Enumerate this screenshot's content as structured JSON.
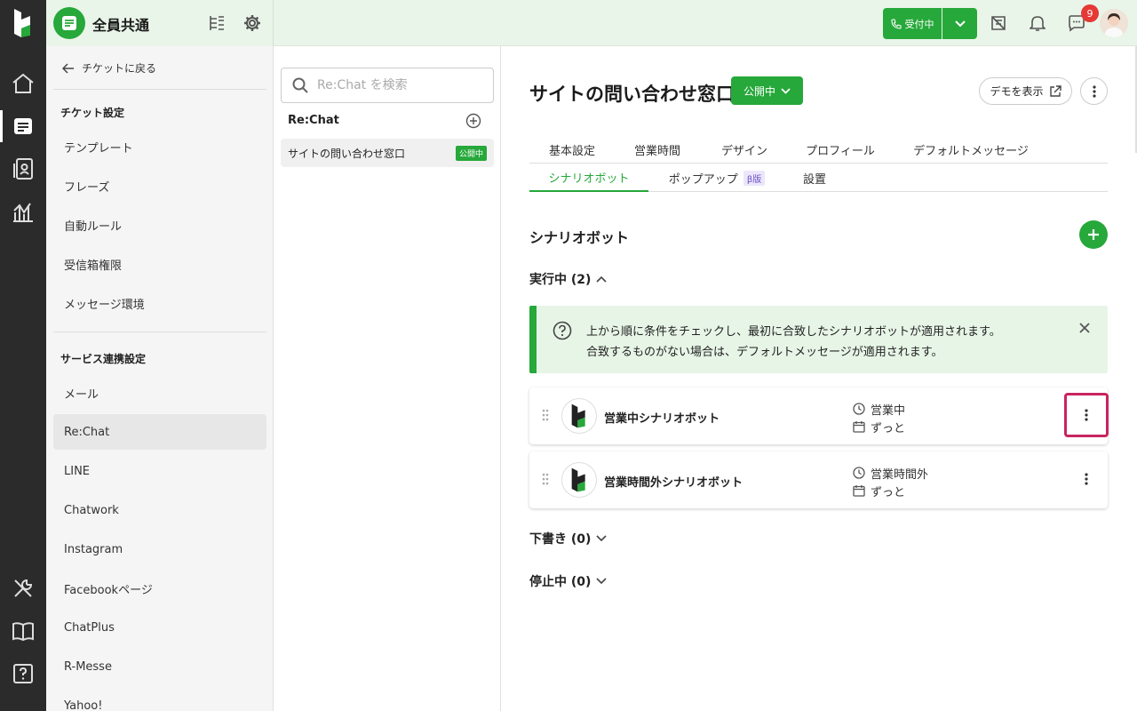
{
  "topbar": {
    "title": "全員共通",
    "status_label": "受付中",
    "notification_count": "9"
  },
  "settings_sidebar": {
    "back_label": "チケットに戻る",
    "ticket_section_title": "チケット設定",
    "ticket_items": [
      "テンプレート",
      "フレーズ",
      "自動ルール",
      "受信箱権限",
      "メッセージ環境"
    ],
    "service_section_title": "サービス連携設定",
    "service_items": [
      "メール",
      "Re:Chat",
      "LINE",
      "Chatwork",
      "Instagram",
      "Facebookページ",
      "ChatPlus",
      "R-Messe",
      "Yahoo!"
    ],
    "active_item": "Re:Chat"
  },
  "list_panel": {
    "search_placeholder": "Re:Chat を検索",
    "header": "Re:Chat",
    "item_label": "サイトの問い合わせ窓口",
    "item_badge": "公開中"
  },
  "main": {
    "title": "サイトの問い合わせ窓口",
    "status_dropdown": "公開中",
    "demo_button": "デモを表示",
    "tabs_row1": [
      "基本設定",
      "営業時間",
      "デザイン",
      "プロフィール",
      "デフォルトメッセージ"
    ],
    "tabs_row2": [
      "シナリオボット",
      "ポップアップ",
      "設置"
    ],
    "beta_badge": "β版",
    "active_tab": "シナリオボット",
    "section_title": "シナリオボット",
    "running_group": "実行中 (2)",
    "info_line1": "上から順に条件をチェックし、最初に合致したシナリオボットが適用されます。",
    "info_line2": "合致するものがない場合は、デフォルトメッセージが適用されます。",
    "bots": [
      {
        "name": "営業中シナリオボット",
        "condition": "営業中",
        "period": "ずっと"
      },
      {
        "name": "営業時間外シナリオボット",
        "condition": "営業時間外",
        "period": "ずっと"
      }
    ],
    "draft_group": "下書き (0)",
    "stopped_group": "停止中 (0)"
  },
  "colors": {
    "accent": "#26a83a",
    "rail": "#2b2b2b",
    "topbar_bg": "#e9f5e9",
    "focus_ring": "#c9245f"
  }
}
